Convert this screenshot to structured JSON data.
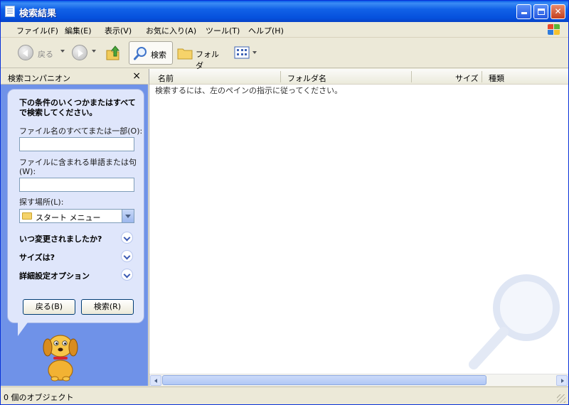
{
  "window": {
    "title": "検索結果",
    "icon": "document-icon",
    "controls": [
      "minimize",
      "maximize",
      "close"
    ]
  },
  "menu": {
    "items": [
      "ファイル(F)",
      "編集(E)",
      "表示(V)",
      "お気に入り(A)",
      "ツール(T)",
      "ヘルプ(H)"
    ]
  },
  "toolbar": {
    "back_label": "戻る",
    "search_label": "検索",
    "folder_label": "フォルダ"
  },
  "left_pane": {
    "title": "検索コンパニオン",
    "close_glyph": "×",
    "heading": "下の条件のいくつかまたはすべてで検索してください。",
    "filename_label": "ファイル名のすべてまたは一部(O):",
    "filename_value": "",
    "word_label": "ファイルに含まれる単語または句(W):",
    "word_value": "",
    "location_label": "探す場所(L):",
    "location_value": "スタート メニュー",
    "options": [
      "いつ変更されましたか?",
      "サイズは?",
      "詳細設定オプション"
    ],
    "back_button": "戻る(B)",
    "search_button": "検索(R)"
  },
  "results": {
    "columns": [
      "名前",
      "フォルダ名",
      "サイズ",
      "種類"
    ],
    "hint": "検索するには、左のペインの指示に従ってください。"
  },
  "status": {
    "text": "0 個のオブジェクト"
  },
  "colors": {
    "title_bar": "#0651dd",
    "pane_blue": "#6f92e8",
    "bubble": "#dfe6fb",
    "chrome": "#ece9d8"
  }
}
